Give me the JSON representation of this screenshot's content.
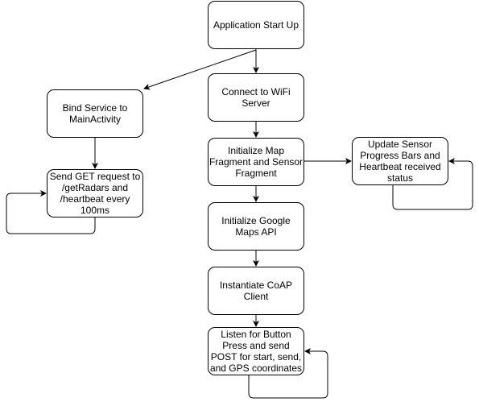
{
  "colors": {
    "stroke": "#000000",
    "fill": "#ffffff",
    "text": "#000000"
  },
  "nodes": {
    "start": {
      "label": "Application Start Up"
    },
    "connect": {
      "label": "Connect to WiFi Server"
    },
    "init_map": {
      "label": "Initialize Map Fragment and Sensor Fragment"
    },
    "init_google": {
      "label": "Initialize Google Maps API"
    },
    "coap": {
      "label": "Instantiate CoAP Client"
    },
    "listen": {
      "label": "Listen for Button Press and send POST for start, send, and GPS coordinates"
    },
    "bind": {
      "label": "Bind Service to MainActivity"
    },
    "send_get": {
      "label": "Send GET request to /getRadars and /heartbeat every 100ms"
    },
    "update": {
      "label": "Update Sensor Progress Bars and Heartbeat received status"
    }
  },
  "edges": [
    {
      "from": "start",
      "to": "connect"
    },
    {
      "from": "start",
      "to": "bind"
    },
    {
      "from": "connect",
      "to": "init_map"
    },
    {
      "from": "init_map",
      "to": "init_google"
    },
    {
      "from": "init_map",
      "to": "update"
    },
    {
      "from": "init_google",
      "to": "coap"
    },
    {
      "from": "coap",
      "to": "listen"
    },
    {
      "from": "bind",
      "to": "send_get"
    },
    {
      "from": "send_get",
      "to": "send_get"
    },
    {
      "from": "update",
      "to": "update"
    },
    {
      "from": "listen",
      "to": "listen"
    }
  ]
}
